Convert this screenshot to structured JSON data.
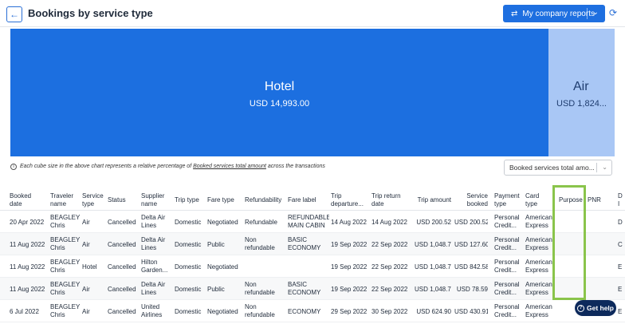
{
  "header": {
    "title": "Bookings by service type",
    "reports_label": "My company reports"
  },
  "chart_data": {
    "type": "treemap",
    "items": [
      {
        "label": "Hotel",
        "value_text": "USD 14,993.00"
      },
      {
        "label": "Air",
        "value_text": "USD 1,824..."
      }
    ]
  },
  "note": {
    "prefix": "Each cube size in the above chart represents a relative percentage of",
    "link": "Booked services total amount",
    "suffix": "across the transactions"
  },
  "metric_select": {
    "value": "Booked services total amo..."
  },
  "table": {
    "columns": [
      [
        "Booked",
        "date"
      ],
      [
        "Traveler",
        "name"
      ],
      [
        "Service",
        "type"
      ],
      [
        "Status",
        ""
      ],
      [
        "Supplier",
        "name"
      ],
      [
        "Trip type",
        ""
      ],
      [
        "Fare type",
        ""
      ],
      [
        "Refundability",
        ""
      ],
      [
        "Fare label",
        ""
      ],
      [
        "Trip",
        "departure..."
      ],
      [
        "Trip return",
        "date"
      ],
      [
        "Trip amount",
        ""
      ],
      [
        "Service",
        "booked"
      ],
      [
        "Payment",
        "type"
      ],
      [
        "Card",
        "type"
      ],
      [
        "Purpose",
        ""
      ],
      [
        "PNR",
        ""
      ],
      [
        "D",
        "I"
      ]
    ],
    "rows": [
      [
        [
          "20 Apr 2022"
        ],
        [
          "BEAGLEY",
          "Chris"
        ],
        [
          "Air"
        ],
        [
          "Cancelled"
        ],
        [
          "Delta Air",
          "Lines"
        ],
        [
          "Domestic"
        ],
        [
          "Negotiated"
        ],
        [
          "Refundable"
        ],
        [
          "REFUNDABLE",
          "MAIN CABIN"
        ],
        [
          "14 Aug 2022"
        ],
        [
          "14 Aug 2022"
        ],
        [
          "USD 200.52"
        ],
        [
          "USD 200.52"
        ],
        [
          "Personal",
          "Credit..."
        ],
        [
          "American",
          "Express"
        ],
        [
          ""
        ],
        [
          ""
        ],
        [
          "D"
        ]
      ],
      [
        [
          "11 Aug 2022"
        ],
        [
          "BEAGLEY",
          "Chris"
        ],
        [
          "Air"
        ],
        [
          "Cancelled"
        ],
        [
          "Delta Air",
          "Lines"
        ],
        [
          "Domestic"
        ],
        [
          "Public"
        ],
        [
          "Non",
          "refundable"
        ],
        [
          "BASIC",
          "ECONOMY"
        ],
        [
          "19 Sep 2022"
        ],
        [
          "22 Sep 2022"
        ],
        [
          "USD 1,048.77"
        ],
        [
          "USD 127.60"
        ],
        [
          "Personal",
          "Credit..."
        ],
        [
          "American",
          "Express"
        ],
        [
          ""
        ],
        [
          ""
        ],
        [
          "C"
        ]
      ],
      [
        [
          "11 Aug 2022"
        ],
        [
          "BEAGLEY",
          "Chris"
        ],
        [
          "Hotel"
        ],
        [
          "Cancelled"
        ],
        [
          "Hilton",
          "Garden..."
        ],
        [
          "Domestic"
        ],
        [
          "Negotiated"
        ],
        [
          ""
        ],
        [
          ""
        ],
        [
          "19 Sep 2022"
        ],
        [
          "22 Sep 2022"
        ],
        [
          "USD 1,048.77"
        ],
        [
          "USD 842.58"
        ],
        [
          "Personal",
          "Credit..."
        ],
        [
          "American",
          "Express"
        ],
        [
          ""
        ],
        [
          ""
        ],
        [
          "E"
        ]
      ],
      [
        [
          "11 Aug 2022"
        ],
        [
          "BEAGLEY",
          "Chris"
        ],
        [
          "Air"
        ],
        [
          "Cancelled"
        ],
        [
          "Delta Air",
          "Lines"
        ],
        [
          "Domestic"
        ],
        [
          "Public"
        ],
        [
          "Non",
          "refundable"
        ],
        [
          "BASIC",
          "ECONOMY"
        ],
        [
          "19 Sep 2022"
        ],
        [
          "22 Sep 2022"
        ],
        [
          "USD 1,048.77"
        ],
        [
          "USD 78.59"
        ],
        [
          "Personal",
          "Credit..."
        ],
        [
          "American",
          "Express"
        ],
        [
          ""
        ],
        [
          ""
        ],
        [
          "E"
        ]
      ],
      [
        [
          "6 Jul 2022"
        ],
        [
          "BEAGLEY",
          "Chris"
        ],
        [
          "Air"
        ],
        [
          "Cancelled"
        ],
        [
          "United",
          "Airlines"
        ],
        [
          "Domestic"
        ],
        [
          "Negotiated"
        ],
        [
          "Non",
          "refundable"
        ],
        [
          "ECONOMY"
        ],
        [
          "29 Sep 2022"
        ],
        [
          "30 Sep 2022"
        ],
        [
          "USD 624.90"
        ],
        [
          "USD 430.91"
        ],
        [
          "Personal",
          "Credit..."
        ],
        [
          "American",
          "Express"
        ],
        [
          ""
        ],
        [
          ""
        ],
        [
          "E"
        ]
      ]
    ]
  },
  "help": {
    "label": "Get help"
  },
  "colors": {
    "primary": "#1c6fe0",
    "air_cell": "#a9c7f5",
    "highlight": "#8ac44b",
    "help_bg": "#0d2a5c"
  }
}
